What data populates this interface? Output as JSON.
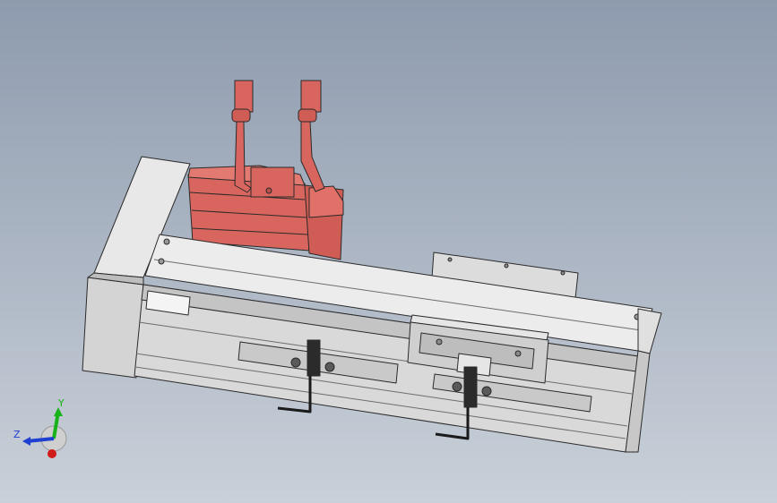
{
  "viewport": {
    "background_top": "#8e9bae",
    "background_bottom": "#c9d0d9"
  },
  "model": {
    "motor_color": "#d9665e",
    "body_color": "#d6d6d6",
    "edge_color": "#2a2a2a"
  },
  "triad": {
    "x_label": "",
    "y_label": "Y",
    "z_label": "Z",
    "x_color": "#d11a1a",
    "y_color": "#18b318",
    "z_color": "#1f3fd0"
  }
}
